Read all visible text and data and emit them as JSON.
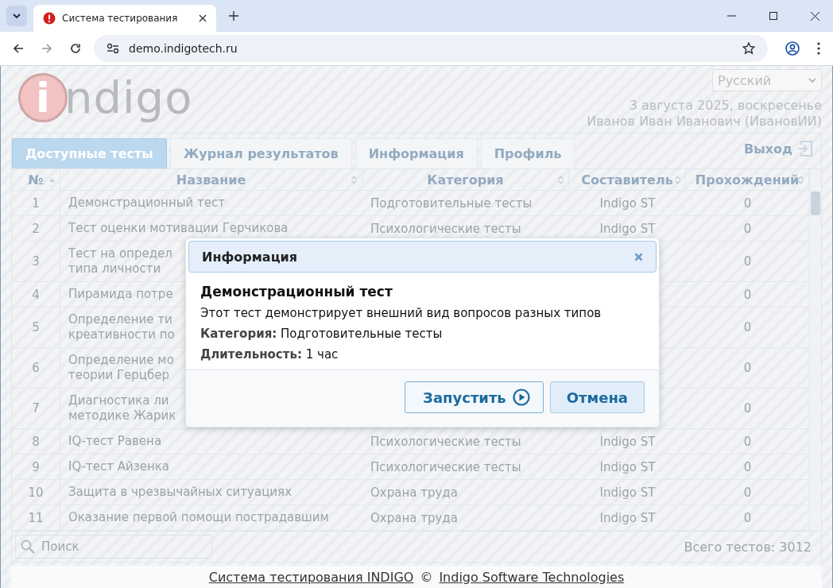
{
  "browser": {
    "tab_title": "Система тестирования",
    "url": "demo.indigotech.ru"
  },
  "header": {
    "logo": {
      "letter": "i",
      "text": "ndigo"
    },
    "language": "Русский",
    "date": "3 августа 2025, воскресенье",
    "user": "Иванов Иван Иванович (ИвановИИ)"
  },
  "tabs": [
    {
      "label": "Доступные тесты",
      "selected": true
    },
    {
      "label": "Журнал результатов",
      "selected": false
    },
    {
      "label": "Информация",
      "selected": false
    },
    {
      "label": "Профиль",
      "selected": false
    }
  ],
  "logout": "Выход",
  "table": {
    "columns": [
      {
        "label": "№",
        "sorted": true
      },
      {
        "label": "Название",
        "sorted": false
      },
      {
        "label": "Категория",
        "sorted": false
      },
      {
        "label": "Составитель",
        "sorted": false
      },
      {
        "label": "Прохождений",
        "sorted": false
      }
    ],
    "rows": [
      {
        "number": "1",
        "name_lines": [
          "Демонстрационный тест"
        ],
        "category": "Подготовительные тесты",
        "author": "Indigo ST",
        "passes": "0"
      },
      {
        "number": "2",
        "name_lines": [
          "Тест оценки мотивации Герчикова"
        ],
        "category": "Психологические тесты",
        "author": "Indigo ST",
        "passes": "0"
      },
      {
        "number": "3",
        "name_lines": [
          "Тест на определ",
          "типа личности"
        ],
        "passes": "0"
      },
      {
        "number": "4",
        "name_lines": [
          "Пирамида потре"
        ],
        "passes": "0"
      },
      {
        "number": "5",
        "name_lines": [
          "Определение ти",
          "креативности по"
        ],
        "passes": "0"
      },
      {
        "number": "6",
        "name_lines": [
          "Определение мо",
          "теории Герцбер"
        ],
        "passes": "0"
      },
      {
        "number": "7",
        "name_lines": [
          "Диагностика ли",
          "методике Жарик"
        ],
        "passes": "0"
      },
      {
        "number": "8",
        "name_lines": [
          "IQ-тест Равена"
        ],
        "category": "Психологические тесты",
        "author": "Indigo ST",
        "passes": "0"
      },
      {
        "number": "9",
        "name_lines": [
          "IQ-тест Айзенка"
        ],
        "category": "Психологические тесты",
        "author": "Indigo ST",
        "passes": "0"
      },
      {
        "number": "10",
        "name_lines": [
          "Защита в чрезвычайных ситуациях"
        ],
        "category": "Охрана труда",
        "author": "Indigo ST",
        "passes": "0"
      },
      {
        "number": "11",
        "name_lines": [
          "Оказание первой помощи пострадавшим"
        ],
        "category": "Охрана труда",
        "author": "Indigo ST",
        "passes": "0"
      }
    ]
  },
  "search": {
    "placeholder": "Поиск"
  },
  "total": "Всего тестов: 3012",
  "footer": {
    "link_1": "Система тестирования INDIGO",
    "separator": "©",
    "link_2": "Indigo Software Technologies"
  },
  "modal": {
    "title": "Информация",
    "heading": "Демонстрационный тест",
    "description": "Этот тест демонстрирует внешний вид вопросов разных типов",
    "fields": [
      "**Категория:** Подготовительные тесты",
      "**Длительность:** 1 час"
    ],
    "buttons": [
      {
        "label": "Запустить",
        "kind": "primary"
      },
      {
        "label": "Отмена",
        "kind": "secondary"
      }
    ]
  }
}
